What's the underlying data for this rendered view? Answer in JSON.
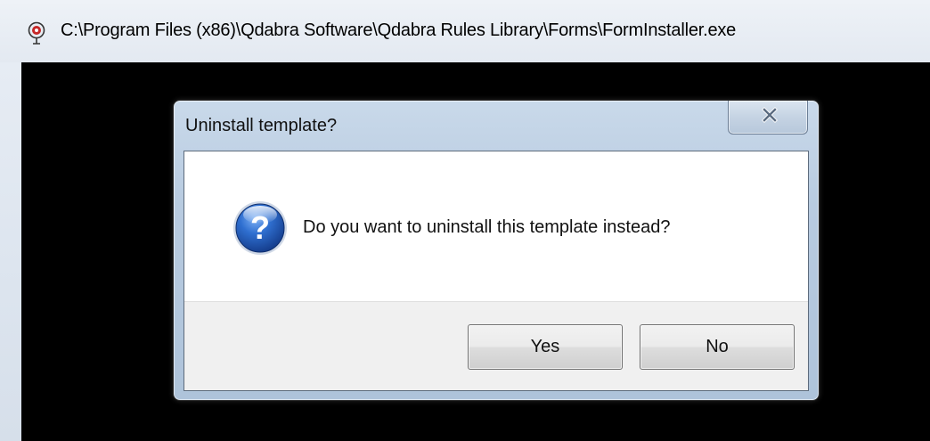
{
  "console_window": {
    "title": "C:\\Program Files (x86)\\Qdabra Software\\Qdabra Rules Library\\Forms\\FormInstaller.exe",
    "app_icon": "qdabra-app-icon",
    "background_color": "#000000"
  },
  "dialog": {
    "title": "Uninstall template?",
    "close_icon": "close-icon",
    "message_icon": "question-icon",
    "message": "Do you want to uninstall this template instead?",
    "buttons": {
      "yes_label": "Yes",
      "no_label": "No"
    }
  }
}
